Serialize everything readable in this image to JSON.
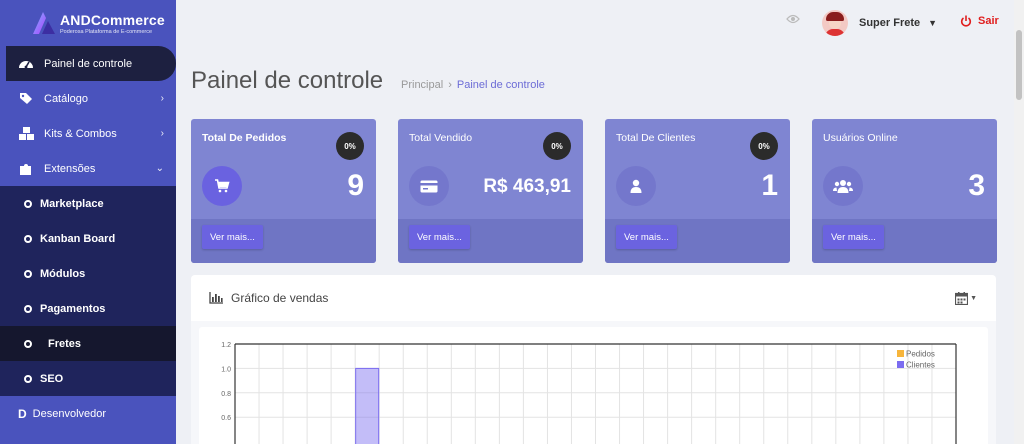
{
  "brand": {
    "name": "ANDCommerce",
    "tagline": "Poderosa Plataforma de E-commerce"
  },
  "sidebar": {
    "items": [
      {
        "label": "Painel de controle",
        "icon": "dashboard-icon",
        "active": true
      },
      {
        "label": "Catálogo",
        "icon": "tags-icon",
        "has_children": true
      },
      {
        "label": "Kits & Combos",
        "icon": "cubes-icon",
        "has_children": true
      },
      {
        "label": "Extensões",
        "icon": "puzzle-icon",
        "expanded": true
      }
    ],
    "submenu": [
      {
        "label": "Marketplace"
      },
      {
        "label": "Kanban Board"
      },
      {
        "label": "Módulos"
      },
      {
        "label": "Pagamentos"
      },
      {
        "label": "Fretes",
        "active": true
      },
      {
        "label": "SEO"
      }
    ],
    "developer": {
      "letter": "D",
      "label": "Desenvolvedor"
    }
  },
  "topbar": {
    "user_name": "Super Frete",
    "logout_label": "Sair"
  },
  "page": {
    "title": "Painel de controle",
    "breadcrumb_home": "Principal",
    "breadcrumb_sep": "›",
    "breadcrumb_current": "Painel de controle"
  },
  "cards": [
    {
      "title": "Total De Pedidos",
      "badge": "0%",
      "value": "9",
      "button": "Ver mais...",
      "icon": "cart-icon"
    },
    {
      "title": "Total Vendido",
      "badge": "0%",
      "value": "R$ 463,91",
      "button": "Ver mais...",
      "icon": "credit-card-icon"
    },
    {
      "title": "Total De Clientes",
      "badge": "0%",
      "value": "1",
      "button": "Ver mais...",
      "icon": "user-icon"
    },
    {
      "title": "Usuários Online",
      "value": "3",
      "button": "Ver mais...",
      "icon": "users-icon"
    }
  ],
  "sales_panel": {
    "title": "Gráfico de vendas"
  },
  "colors": {
    "sidebar": "#4a53bd",
    "card": "#7f85d2",
    "accent": "#6b63e0",
    "logout": "#e01e1e",
    "pedidos": "#f7b53b",
    "clientes": "#7b6cf0"
  },
  "chart_data": {
    "type": "bar",
    "y_ticks": [
      "1.2",
      "1.0",
      "0.8",
      "0.6"
    ],
    "ylim": [
      0,
      1.2
    ],
    "grid": true,
    "legend_position": "top-right",
    "series": [
      {
        "name": "Pedidos",
        "color": "#f7b53b",
        "values": [
          0,
          0,
          0,
          0,
          0,
          0,
          0,
          0,
          0,
          0,
          0,
          0,
          0,
          0,
          0,
          0,
          0,
          0,
          0,
          0,
          0,
          0,
          0,
          0,
          0,
          0,
          0,
          0,
          0,
          0
        ]
      },
      {
        "name": "Clientes",
        "color": "#7b6cf0",
        "values": [
          0,
          0,
          0,
          0,
          0,
          1,
          0,
          0,
          0,
          0,
          0,
          0,
          0,
          0,
          0,
          0,
          0,
          0,
          0,
          0,
          0,
          0,
          0,
          0,
          0,
          0,
          0,
          0,
          0,
          0
        ]
      }
    ]
  }
}
